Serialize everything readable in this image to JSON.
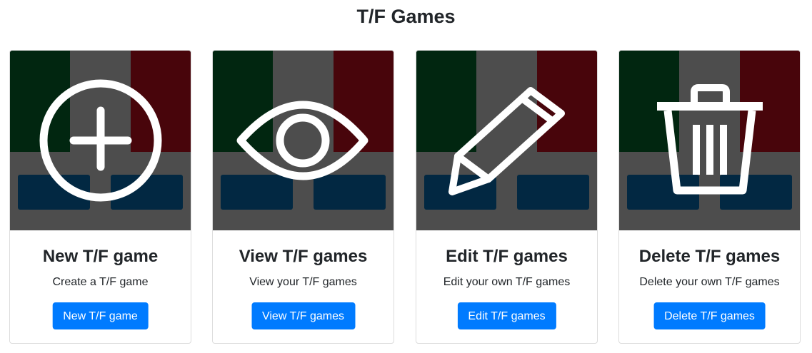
{
  "page": {
    "title": "T/F Games"
  },
  "colors": {
    "green": "#012610",
    "gray": "#4d4d4d",
    "red": "#48050b",
    "blue": "#022842",
    "icon": "#ffffff",
    "button": "#007bff"
  },
  "cards": [
    {
      "icon": "plus-circle-icon",
      "title": "New T/F game",
      "text": "Create a T/F game",
      "button": "New T/F game"
    },
    {
      "icon": "eye-icon",
      "title": "View T/F games",
      "text": "View your T/F games",
      "button": "View T/F games"
    },
    {
      "icon": "pencil-icon",
      "title": "Edit T/F games",
      "text": "Edit your own T/F games",
      "button": "Edit T/F games"
    },
    {
      "icon": "trash-icon",
      "title": "Delete T/F games",
      "text": "Delete your own T/F games",
      "button": "Delete T/F games"
    }
  ]
}
